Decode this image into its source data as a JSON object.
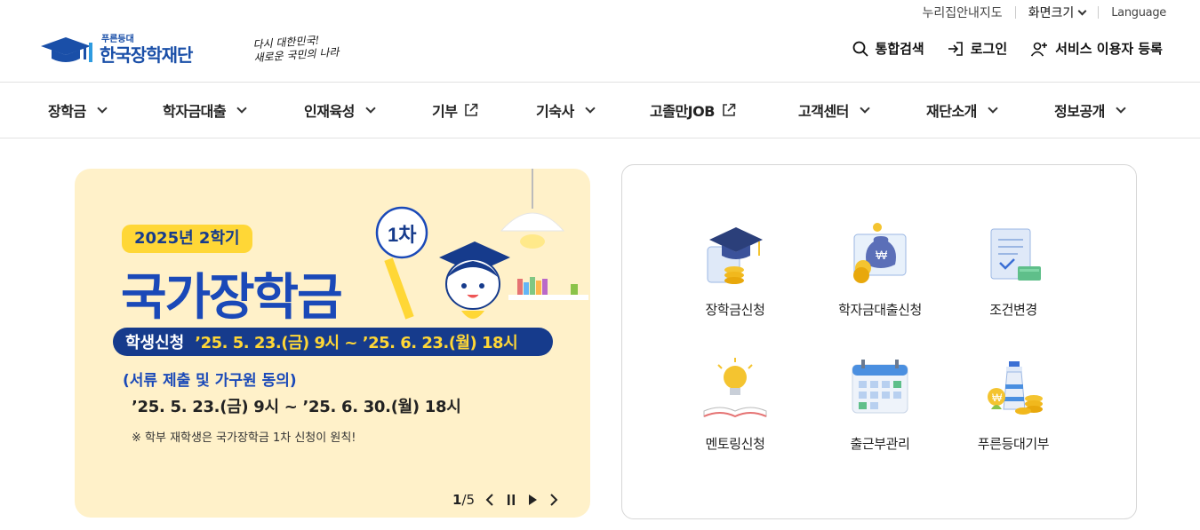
{
  "util": {
    "sitemap": "누리집안내지도",
    "font_size": "화면크기",
    "language": "Language"
  },
  "logo": {
    "small": "푸른등대",
    "big": "한국장학재단",
    "slogan_line1": "다시 대한민국!",
    "slogan_line2": "새로운 국민의 나라"
  },
  "header_actions": [
    {
      "label": "통합검색",
      "icon": "search-icon"
    },
    {
      "label": "로그인",
      "icon": "login-icon"
    },
    {
      "label": "서비스 이용자 등록",
      "icon": "user-add-icon"
    }
  ],
  "nav": [
    {
      "label": "장학금",
      "icon": "chevron-down-icon"
    },
    {
      "label": "학자금대출",
      "icon": "chevron-down-icon"
    },
    {
      "label": "인재육성",
      "icon": "chevron-down-icon"
    },
    {
      "label": "기부",
      "icon": "external-link-icon"
    },
    {
      "label": "기숙사",
      "icon": "chevron-down-icon"
    },
    {
      "label": "고졸만JOB",
      "icon": "external-link-icon"
    },
    {
      "label": "고객센터",
      "icon": "chevron-down-icon"
    },
    {
      "label": "재단소개",
      "icon": "chevron-down-icon"
    },
    {
      "label": "정보공개",
      "icon": "chevron-down-icon"
    }
  ],
  "banner": {
    "tag": "2025년 2학기",
    "headline": "국가장학금",
    "badge": "1차",
    "period_label": "학생신청",
    "period_dates": "’25. 5. 23.(금) 9시 ~ ’25. 6. 23.(월) 18시",
    "docs_label": "(서류 제출 및 가구원 동의)",
    "docs_dates": "’25. 5. 23.(금) 9시 ~ ’25. 6. 30.(월) 18시",
    "note": "※ 학부 재학생은 국가장학금 1차 신청이 원칙!",
    "slide_current": "1",
    "slide_total": "/5",
    "colors": {
      "background": "#fff1c9",
      "accent": "#1a49b8",
      "navy": "#163b8c",
      "yellow": "#ffd736"
    }
  },
  "quick_links": [
    {
      "label": "장학금신청",
      "icon": "graduation-cap-icon"
    },
    {
      "label": "학자금대출신청",
      "icon": "money-bag-icon"
    },
    {
      "label": "조건변경",
      "icon": "document-edit-icon"
    },
    {
      "label": "멘토링신청",
      "icon": "lightbulb-book-icon"
    },
    {
      "label": "출근부관리",
      "icon": "calendar-icon"
    },
    {
      "label": "푸른등대기부",
      "icon": "lighthouse-coins-icon"
    }
  ]
}
